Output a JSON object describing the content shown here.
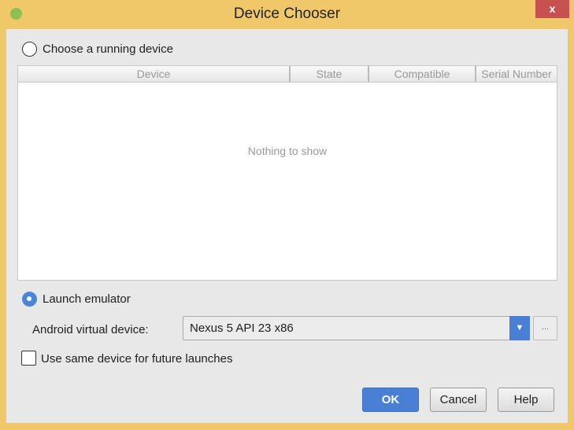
{
  "window": {
    "title": "Device Chooser",
    "close_label": "x"
  },
  "running": {
    "label": "Choose a running device",
    "selected": false
  },
  "table": {
    "columns": [
      "Device",
      "State",
      "Compatible",
      "Serial Number"
    ],
    "empty_text": "Nothing to show"
  },
  "emulator": {
    "label": "Launch emulator",
    "selected": true,
    "avd_label": "Android virtual device:",
    "avd_value": "Nexus 5 API 23 x86",
    "more_label": "..."
  },
  "same_device": {
    "label": "Use same device for future launches",
    "checked": false
  },
  "buttons": {
    "ok": "OK",
    "cancel": "Cancel",
    "help": "Help"
  }
}
